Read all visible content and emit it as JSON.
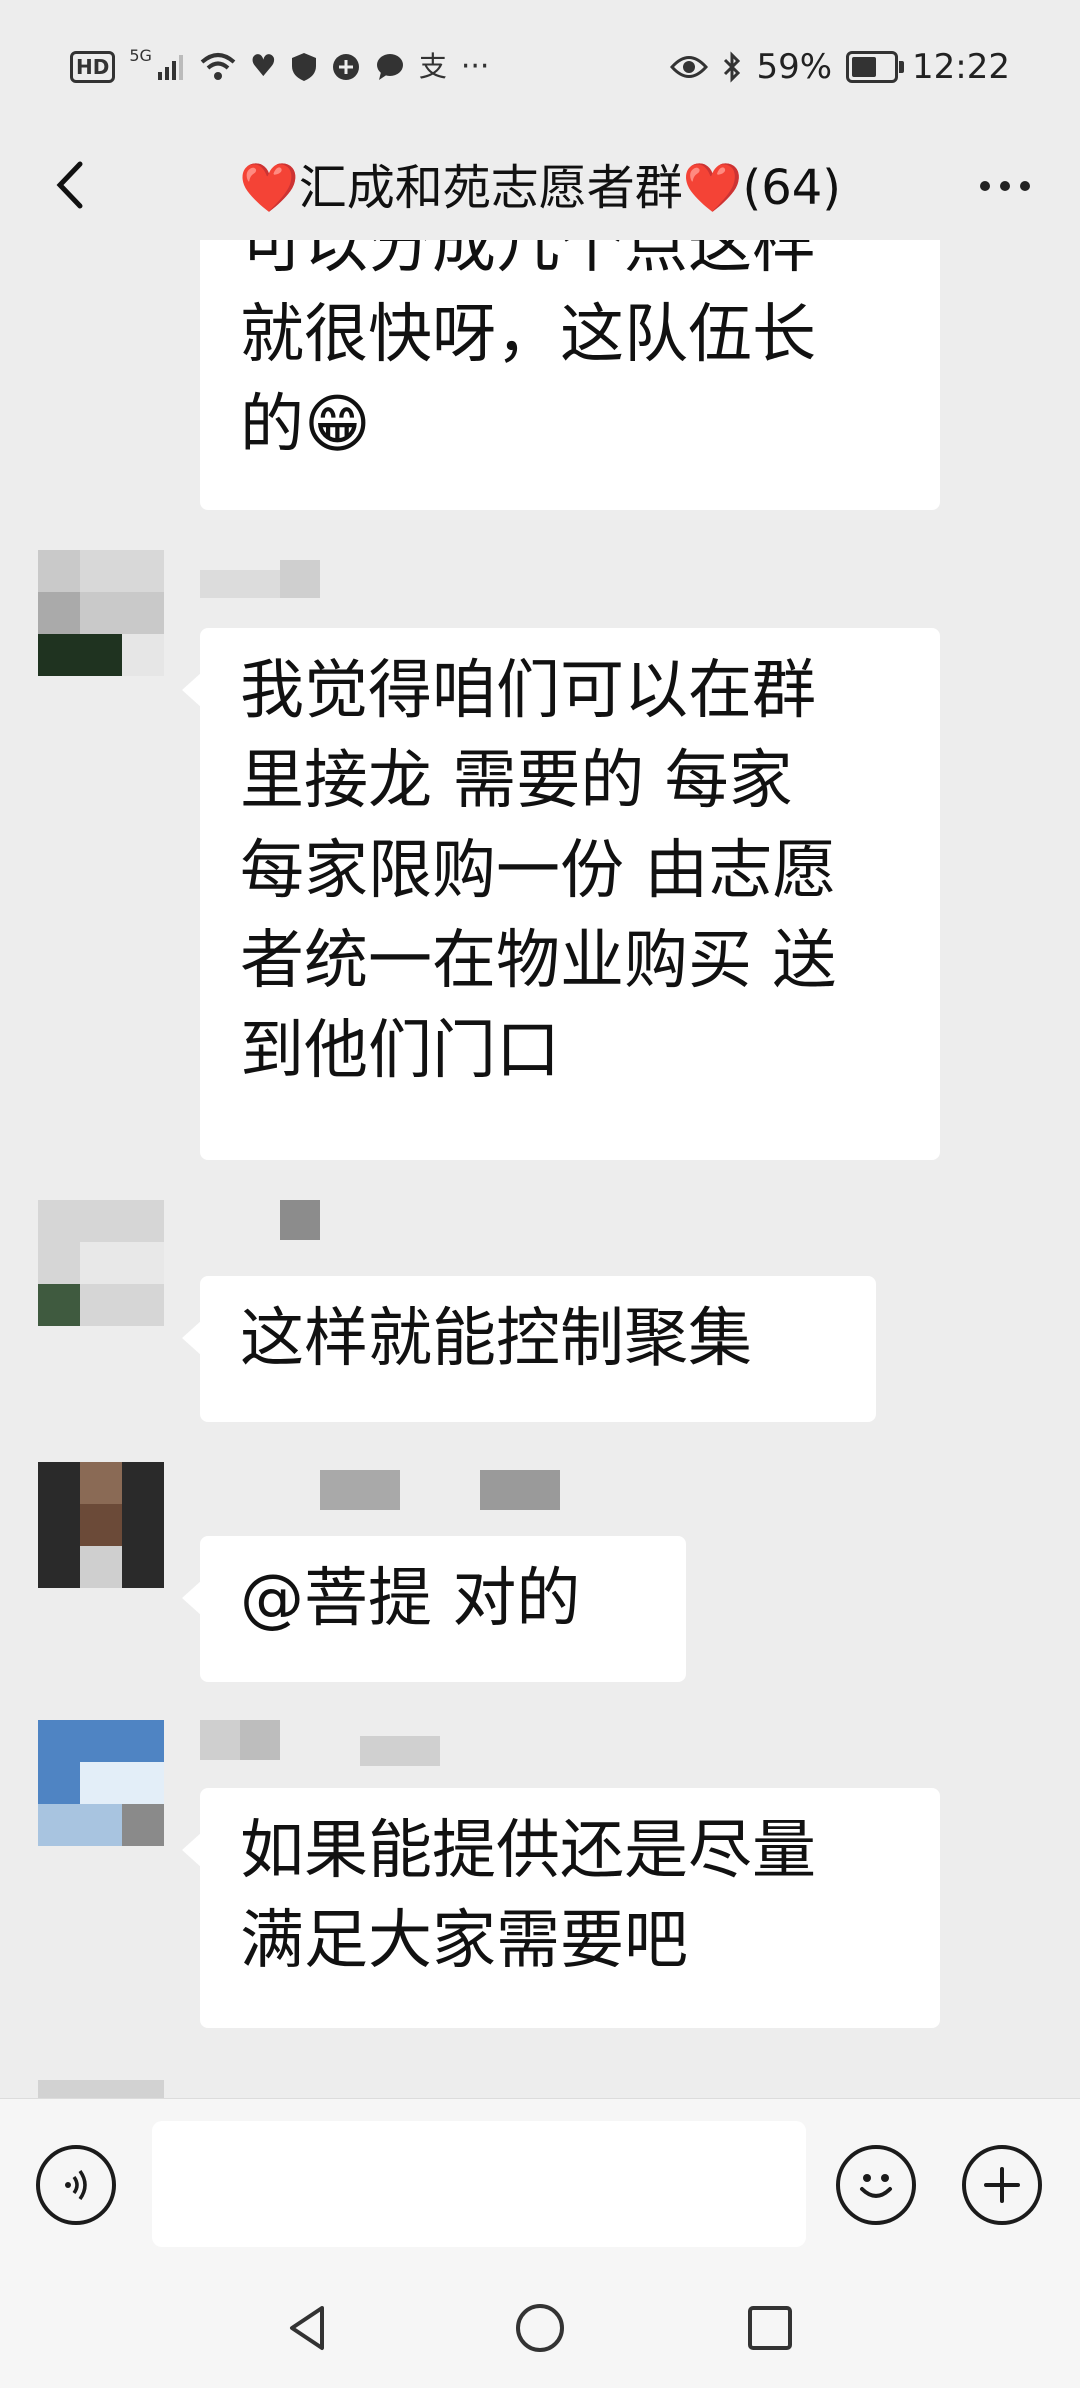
{
  "status_bar": {
    "network": "HD",
    "network_type": "5G",
    "more": "···",
    "battery": "59%",
    "battery_level": 0.59,
    "time": "12:22"
  },
  "header": {
    "heart_left": "❤️",
    "group_name": "汇成和苑志愿者群",
    "heart_right": "❤️",
    "member_count": "(64)"
  },
  "messages": [
    {
      "lines": [
        "可以分成几个点这样",
        "就很快呀，这队伍长",
        "的😁"
      ]
    },
    {
      "lines": [
        "我觉得咱们可以在群",
        "里接龙 需要的 每家",
        "每家限购一份 由志愿",
        "者统一在物业购买 送",
        "到他们门口"
      ]
    },
    {
      "lines": [
        "这样就能控制聚集"
      ]
    },
    {
      "lines": [
        "@菩提  对的"
      ]
    },
    {
      "lines": [
        "如果能提供还是尽量",
        "满足大家需要吧"
      ]
    }
  ],
  "input": {
    "placeholder": ""
  },
  "colors": {
    "background": "#ededed",
    "bubble": "#ffffff",
    "heart": "#d81e1e"
  },
  "icons": {
    "back": "chevron-left-icon",
    "more": "more-dots-icon",
    "voice": "voice-icon",
    "emoji": "emoji-icon",
    "plus": "plus-icon",
    "nav_back": "triangle-back-icon",
    "nav_home": "circle-home-icon",
    "nav_recent": "square-recent-icon"
  }
}
